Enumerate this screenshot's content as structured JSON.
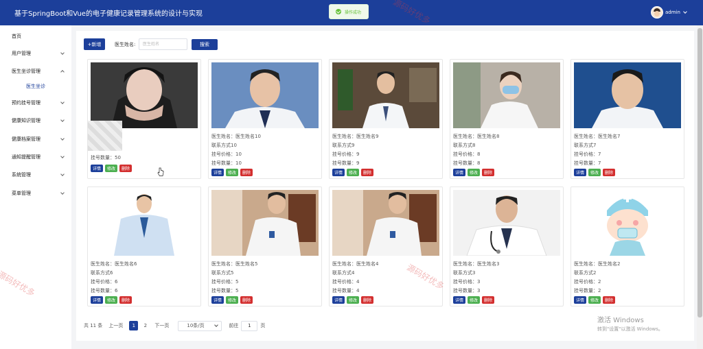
{
  "header": {
    "title": "基于SpringBoot和Vue的电子健康记录管理系统的设计与实现",
    "toast": "操作成功",
    "user": "admin"
  },
  "colors": {
    "primary": "#1c3f9a",
    "success": "#4caf50",
    "danger": "#d32f2f"
  },
  "sidebar": {
    "items": [
      {
        "label": "首页"
      },
      {
        "label": "用户管理"
      },
      {
        "label": "医生坐诊管理",
        "expanded": true,
        "children": [
          {
            "label": "医生坐诊"
          }
        ]
      },
      {
        "label": "预约挂号管理"
      },
      {
        "label": "健康知识管理"
      },
      {
        "label": "健康档案管理"
      },
      {
        "label": "通知提醒管理"
      },
      {
        "label": "系统管理"
      },
      {
        "label": "菜单管理"
      }
    ]
  },
  "toolbar": {
    "add_label": "+新增",
    "search_label": "医生姓名:",
    "search_placeholder": "医生姓名",
    "search_button": "搜索"
  },
  "cards": [
    {
      "lines": [
        "挂号数量：50"
      ],
      "image": "doctor-portrait",
      "redacted": true
    },
    {
      "lines": [
        "医生姓名：医生姓名10",
        "联系方式10",
        "挂号价格：10",
        "挂号数量：10"
      ],
      "image": "doctor-portrait"
    },
    {
      "lines": [
        "医生姓名：医生姓名9",
        "联系方式9",
        "挂号价格：9",
        "挂号数量：9"
      ],
      "image": "doctor-portrait"
    },
    {
      "lines": [
        "医生姓名：医生姓名8",
        "联系方式8",
        "挂号价格：8",
        "挂号数量：8"
      ],
      "image": "doctor-portrait"
    },
    {
      "lines": [
        "医生姓名：医生姓名7",
        "联系方式7",
        "挂号价格：7",
        "挂号数量：7"
      ],
      "image": "doctor-portrait"
    },
    {
      "lines": [
        "医生姓名：医生姓名6",
        "联系方式6",
        "挂号价格：6",
        "挂号数量：6"
      ],
      "image": "doctor-portrait"
    },
    {
      "lines": [
        "医生姓名：医生姓名5",
        "联系方式5",
        "挂号价格：5",
        "挂号数量：5"
      ],
      "image": "doctor-portrait"
    },
    {
      "lines": [
        "医生姓名：医生姓名4",
        "联系方式4",
        "挂号价格：4",
        "挂号数量：4"
      ],
      "image": "doctor-portrait"
    },
    {
      "lines": [
        "医生姓名：医生姓名3",
        "联系方式3",
        "挂号价格：3",
        "挂号数量：3"
      ],
      "image": "doctor-portrait"
    },
    {
      "lines": [
        "医生姓名：医生姓名2",
        "联系方式2",
        "挂号价格：2",
        "挂号数量：2"
      ],
      "image": "cartoon-nurse"
    }
  ],
  "card_actions": {
    "detail": "详情",
    "edit": "修改",
    "delete": "删除"
  },
  "pagination": {
    "total": "共 11 条",
    "prev": "上一页",
    "pages": [
      "1",
      "2"
    ],
    "current": "1",
    "next": "下一页",
    "page_size": "10条/页",
    "goto": "前往",
    "goto_value": "1",
    "unit": "页"
  },
  "watermark": [
    "源码好优多",
    "源码好优多",
    "源码好优多"
  ],
  "activation": {
    "title": "激活 Windows",
    "subtitle": "转到\"设置\"以激活 Windows。"
  }
}
